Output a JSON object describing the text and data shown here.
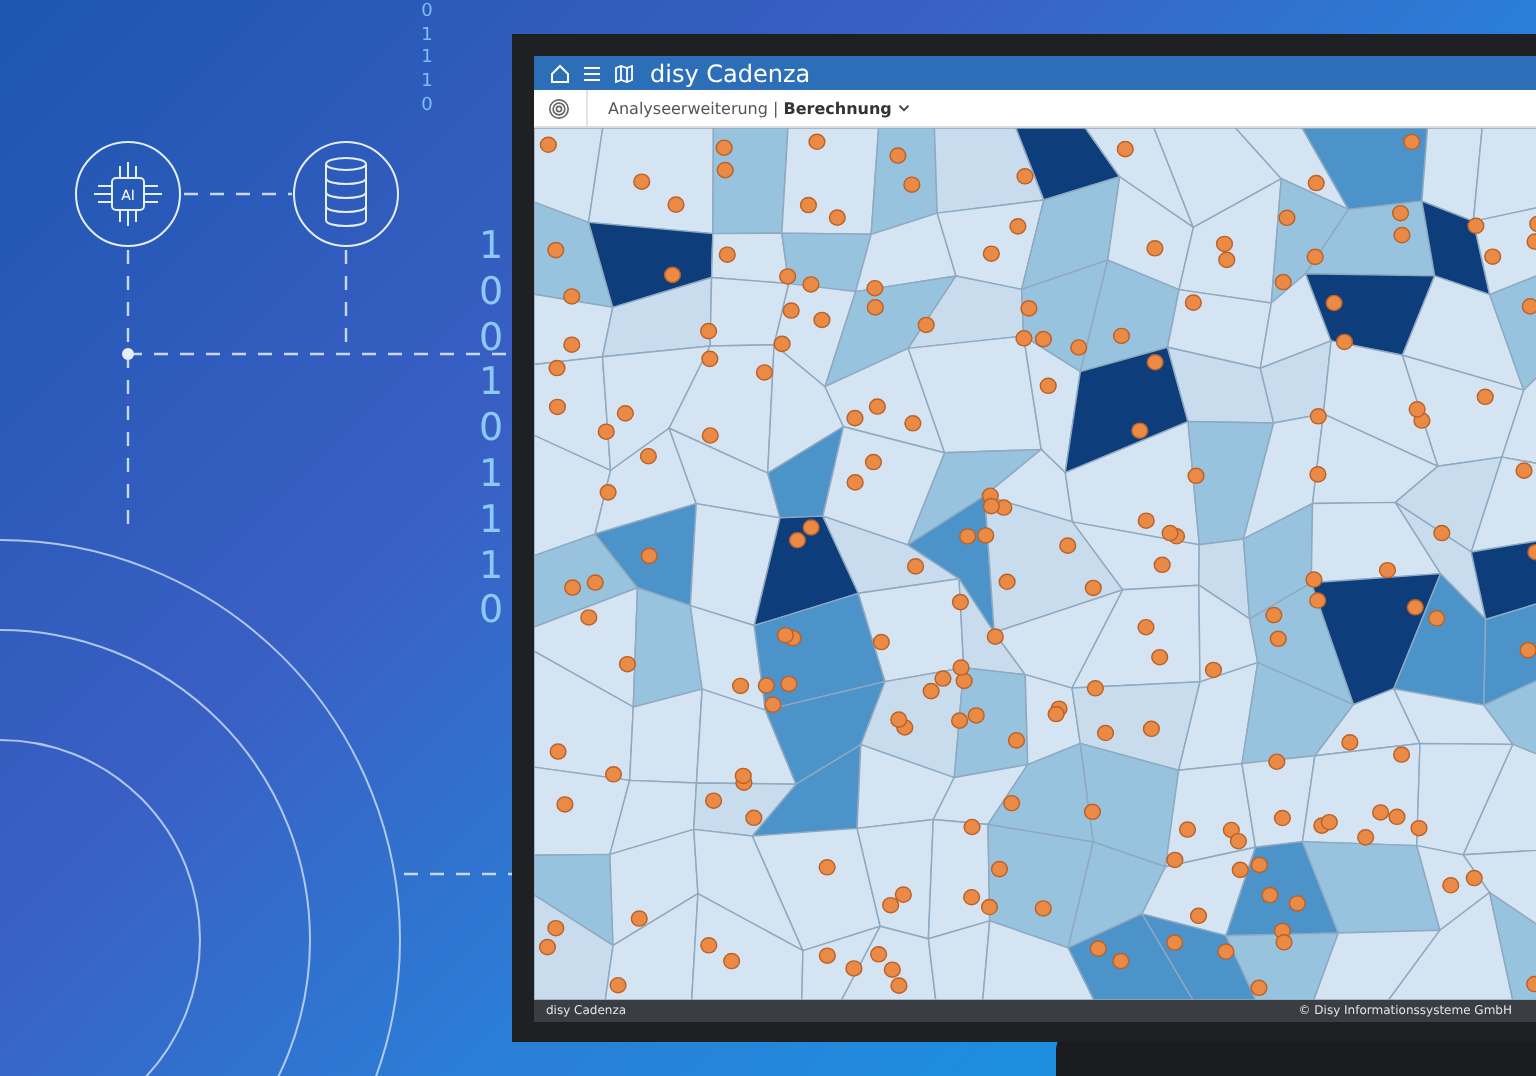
{
  "background": {
    "digit_columns": [
      "01110",
      "100101110"
    ],
    "chip_label": "AI"
  },
  "app": {
    "title": "disy Cadenza",
    "breadcrumb": "Analyseerweiterung | **Berechnung**",
    "footer_left": "disy Cadenza",
    "footer_right": "© Disy Informationssysteme GmbH"
  }
}
